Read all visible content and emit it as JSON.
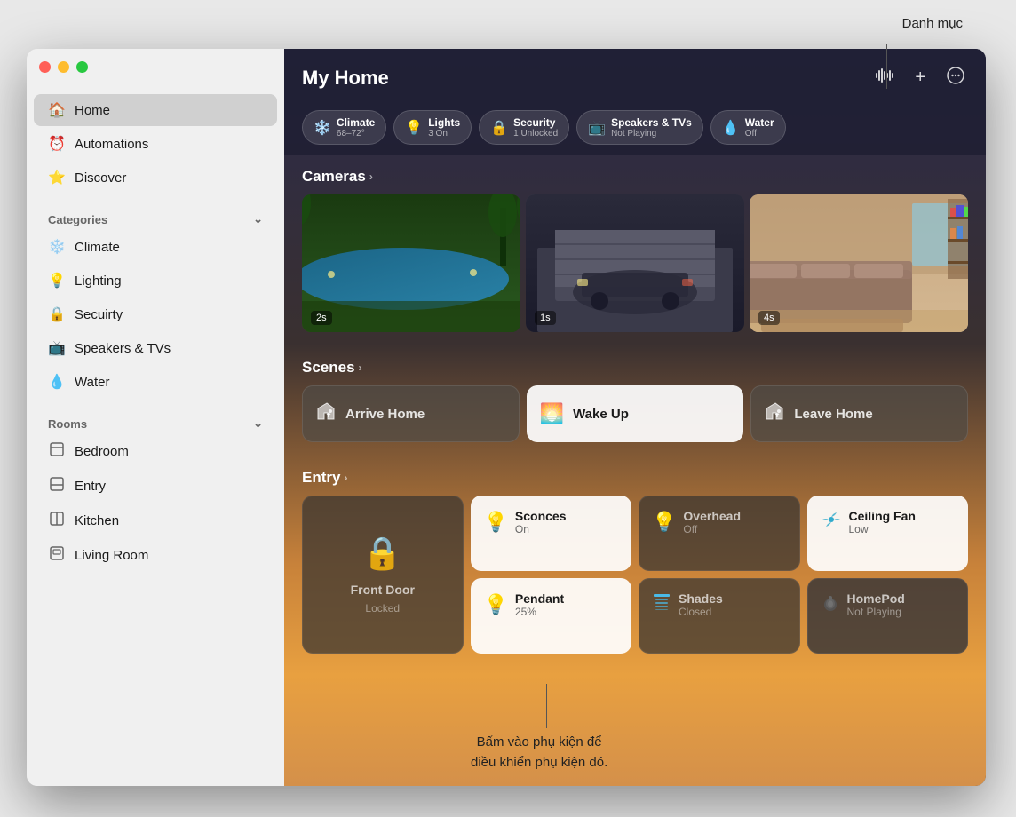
{
  "annotation": {
    "top_label": "Danh mục",
    "bottom_label": "Bấm vào phụ kiện để\nđiều khiển phụ kiện đó."
  },
  "window": {
    "title": "My Home",
    "traffic_lights": [
      "red",
      "yellow",
      "green"
    ],
    "header_buttons": [
      "waveform",
      "plus",
      "ellipsis"
    ]
  },
  "sidebar": {
    "items": [
      {
        "id": "home",
        "icon": "🏠",
        "label": "Home",
        "active": true
      },
      {
        "id": "automations",
        "icon": "⏰",
        "label": "Automations",
        "active": false
      },
      {
        "id": "discover",
        "icon": "⭐",
        "label": "Discover",
        "active": false
      }
    ],
    "categories_header": "Categories",
    "categories": [
      {
        "id": "climate",
        "icon": "❄️",
        "label": "Climate"
      },
      {
        "id": "lighting",
        "icon": "💡",
        "label": "Lighting"
      },
      {
        "id": "security",
        "icon": "🔒",
        "label": "Secuirty"
      },
      {
        "id": "speakers",
        "icon": "📺",
        "label": "Speakers & TVs"
      },
      {
        "id": "water",
        "icon": "💧",
        "label": "Water"
      }
    ],
    "rooms_header": "Rooms",
    "rooms": [
      {
        "id": "bedroom",
        "icon": "⬛",
        "label": "Bedroom"
      },
      {
        "id": "entry",
        "icon": "⬛",
        "label": "Entry"
      },
      {
        "id": "kitchen",
        "icon": "⬛",
        "label": "Kitchen"
      },
      {
        "id": "living-room",
        "icon": "⬛",
        "label": "Living Room"
      }
    ]
  },
  "status_pills": [
    {
      "id": "climate",
      "icon": "❄️",
      "name": "Climate",
      "value": "68–72°"
    },
    {
      "id": "lights",
      "icon": "💡",
      "name": "Lights",
      "value": "3 On"
    },
    {
      "id": "security",
      "icon": "🔒",
      "name": "Security",
      "value": "1 Unlocked"
    },
    {
      "id": "speakers",
      "icon": "📺",
      "name": "Speakers & TVs",
      "value": "Not Playing"
    },
    {
      "id": "water",
      "icon": "💧",
      "name": "Water",
      "value": "Off"
    }
  ],
  "cameras": {
    "section_label": "Cameras",
    "items": [
      {
        "id": "pool-cam",
        "timestamp": "2s"
      },
      {
        "id": "garage-cam",
        "timestamp": "1s"
      },
      {
        "id": "living-cam",
        "timestamp": "4s"
      }
    ]
  },
  "scenes": {
    "section_label": "Scenes",
    "items": [
      {
        "id": "arrive-home",
        "icon": "🚶",
        "label": "Arrive Home",
        "active": false
      },
      {
        "id": "wake-up",
        "icon": "🌅",
        "label": "Wake Up",
        "active": true
      },
      {
        "id": "leave-home",
        "icon": "🚶",
        "label": "Leave Home",
        "active": false
      }
    ]
  },
  "entry": {
    "section_label": "Entry",
    "devices": [
      {
        "id": "front-door",
        "icon": "🔒",
        "name": "Front Door",
        "status": "Locked",
        "type": "lock"
      },
      {
        "id": "sconces",
        "icon": "🟡",
        "name": "Sconces",
        "status": "On",
        "type": "light"
      },
      {
        "id": "overhead",
        "icon": "🟡",
        "name": "Overhead",
        "status": "Off",
        "type": "dim"
      },
      {
        "id": "ceiling-fan",
        "icon": "💠",
        "name": "Ceiling Fan",
        "status": "Low",
        "type": "fan"
      },
      {
        "id": "pendant",
        "icon": "🟡",
        "name": "Pendant",
        "status": "25%",
        "type": "light"
      },
      {
        "id": "shades",
        "icon": "🟦",
        "name": "Shades",
        "status": "Closed",
        "type": "dim"
      },
      {
        "id": "homepod",
        "icon": "⚫",
        "name": "HomePod",
        "status": "Not Playing",
        "type": "speaker"
      }
    ]
  }
}
